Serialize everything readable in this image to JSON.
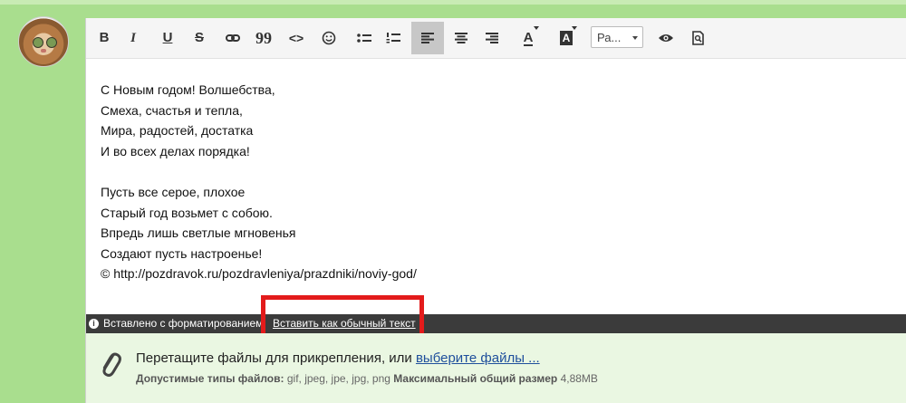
{
  "toolbar": {
    "bold": "B",
    "italic": "I",
    "underline": "U",
    "strike": "S",
    "quote": "99",
    "code": "<>",
    "text_color_glyph": "A",
    "bg_color_glyph": "A",
    "font_size_value": "Ра..."
  },
  "content": {
    "stanza1": [
      "С Новым годом! Волшебства,",
      "Смеха, счастья и тепла,",
      "Мира, радостей, достатка",
      "И во всех делах порядка!"
    ],
    "stanza2": [
      "Пусть все серое, плохое",
      "Старый год возьмет с собою.",
      "Впредь лишь светлые мгновенья",
      "Создают пусть настроенье!",
      "© http://pozdravok.ru/pozdravleniya/prazdniki/noviy-god/"
    ]
  },
  "pastebar": {
    "info_glyph": "i",
    "message": "Вставлено с форматированием",
    "action_link": "Вставить как обычный текст"
  },
  "attach": {
    "drop_text": "Перетащите файлы для прикрепления, или ",
    "choose_link": "выберите файлы ...",
    "types_label": "Допустимые типы файлов:",
    "types_value": " gif, jpeg, jpe, jpg, png ",
    "max_label": "Максимальный общий размер",
    "max_value": " 4,88MB"
  },
  "colors": {
    "page_bg": "#a9de8e",
    "highlight_border": "#e31b1b",
    "pastebar_bg": "#3b3b3b",
    "attach_bg": "#eaf7e2",
    "link": "#1f4f9c"
  }
}
